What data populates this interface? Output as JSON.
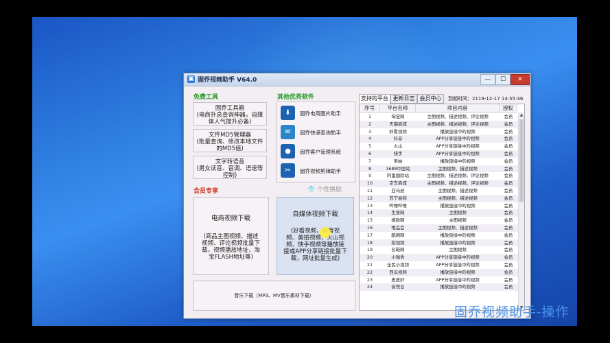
{
  "overlay_caption": "固乔视频助手-操作",
  "window": {
    "title": "固乔视频助手 V64.0",
    "controls": {
      "minimize": "—",
      "maximize": "☐",
      "close": "✕"
    }
  },
  "free_tools": {
    "heading": "免费工具",
    "items": [
      {
        "lines": [
          "固乔工具箱",
          "(电商扑息查询神器，自媒",
          "体人气提升必备)"
        ]
      },
      {
        "lines": [
          "文件MD5管理器",
          "(批量查询、修改本地文件",
          "的MD5值)"
        ]
      },
      {
        "lines": [
          "文字转语音",
          "(男女读音、音调、语速等",
          "控制)"
        ]
      }
    ]
  },
  "other_software": {
    "heading": "其他优秀软件",
    "items": [
      {
        "label": "固乔电商图片助手",
        "icon": "download-icon"
      },
      {
        "label": "固乔快递查询助手",
        "icon": "courier-icon"
      },
      {
        "label": "固乔客户管理系统",
        "icon": "user-icon"
      },
      {
        "label": "固乔视频剪辑助手",
        "icon": "scissors-icon"
      }
    ]
  },
  "skin_button": "个性换肤",
  "member": {
    "heading": "会员专享",
    "ecommerce": {
      "title": "电商视频下载",
      "desc": [
        "(商品主图视频、描述",
        "视频、评论视频批量下",
        "载，视频播放地址，淘",
        "宝FLASH地址等)"
      ]
    },
    "media": {
      "title": "自媒体视频下载",
      "desc": [
        "(好看视频、抖音视",
        "频、美拍视频、火山视",
        "频、快手视频等播放链",
        "接或APP分享链接批量下",
        "载，网址批量生成)"
      ]
    }
  },
  "music_button": "音乐下载（MP3、MV音乐素材下载）",
  "tabs": [
    "支持的平台",
    "更新日志",
    "会员中心"
  ],
  "deadline": "到期时间：2119-12-17 14:55:36",
  "table": {
    "headers": [
      "序号",
      "平台名称",
      "项目内容",
      "授权"
    ],
    "rows": [
      [
        "1",
        "淘宝网",
        "主图视频、描述视频、评论视频",
        "会员"
      ],
      [
        "2",
        "天猫商城",
        "主图视频、描述视频、评论视频",
        "会员"
      ],
      [
        "3",
        "好看视频",
        "播放链接中的视频",
        "会员"
      ],
      [
        "4",
        "抖音",
        "APP分享链接中的视频",
        "会员"
      ],
      [
        "5",
        "火山",
        "APP分享链接中的视频",
        "会员"
      ],
      [
        "6",
        "快手",
        "APP分享链接中的视频",
        "会员"
      ],
      [
        "7",
        "美拍",
        "播放链接中的视频",
        "会员"
      ],
      [
        "8",
        "1688中国站",
        "主图视频、描述视频",
        "会员"
      ],
      [
        "9",
        "阿里国际站",
        "主图视频、描述视频、评论视频",
        "会员"
      ],
      [
        "10",
        "京东商城",
        "主图视频、描述视频、评论视频",
        "会员"
      ],
      [
        "11",
        "亚马逊",
        "主图视频、描述视频",
        "会员"
      ],
      [
        "12",
        "苏宁易购",
        "主图视频、描述视频",
        "会员"
      ],
      [
        "13",
        "哔哩哔哩",
        "播放链接中的视频",
        "会员"
      ],
      [
        "14",
        "生意网",
        "主图视频",
        "会员"
      ],
      [
        "15",
        "搜款网",
        "主图视频",
        "会员"
      ],
      [
        "16",
        "唯品会",
        "主图视频、描述视频",
        "会员"
      ],
      [
        "17",
        "酷燃网",
        "播放链接中的视频",
        "会员"
      ],
      [
        "18",
        "梨视频",
        "播放链接中的视频",
        "会员"
      ],
      [
        "19",
        "名鞋网",
        "主图视频",
        "会员"
      ],
      [
        "20",
        "小咖秀",
        "APP分享链接中的视频",
        "会员"
      ],
      [
        "21",
        "全民小视频",
        "APP分享链接中的视频",
        "会员"
      ],
      [
        "22",
        "西瓜视频",
        "播放链接中的视频",
        "会员"
      ],
      [
        "23",
        "皮皮虾",
        "APP分享链接中的视频",
        "会员"
      ],
      [
        "24",
        "音悦台",
        "播放链接中的视频",
        "会员"
      ]
    ]
  },
  "colors": {
    "free_heading": "#2a9a2a",
    "member_heading": "#d13a2a",
    "desktop": "#2f7fe0"
  }
}
